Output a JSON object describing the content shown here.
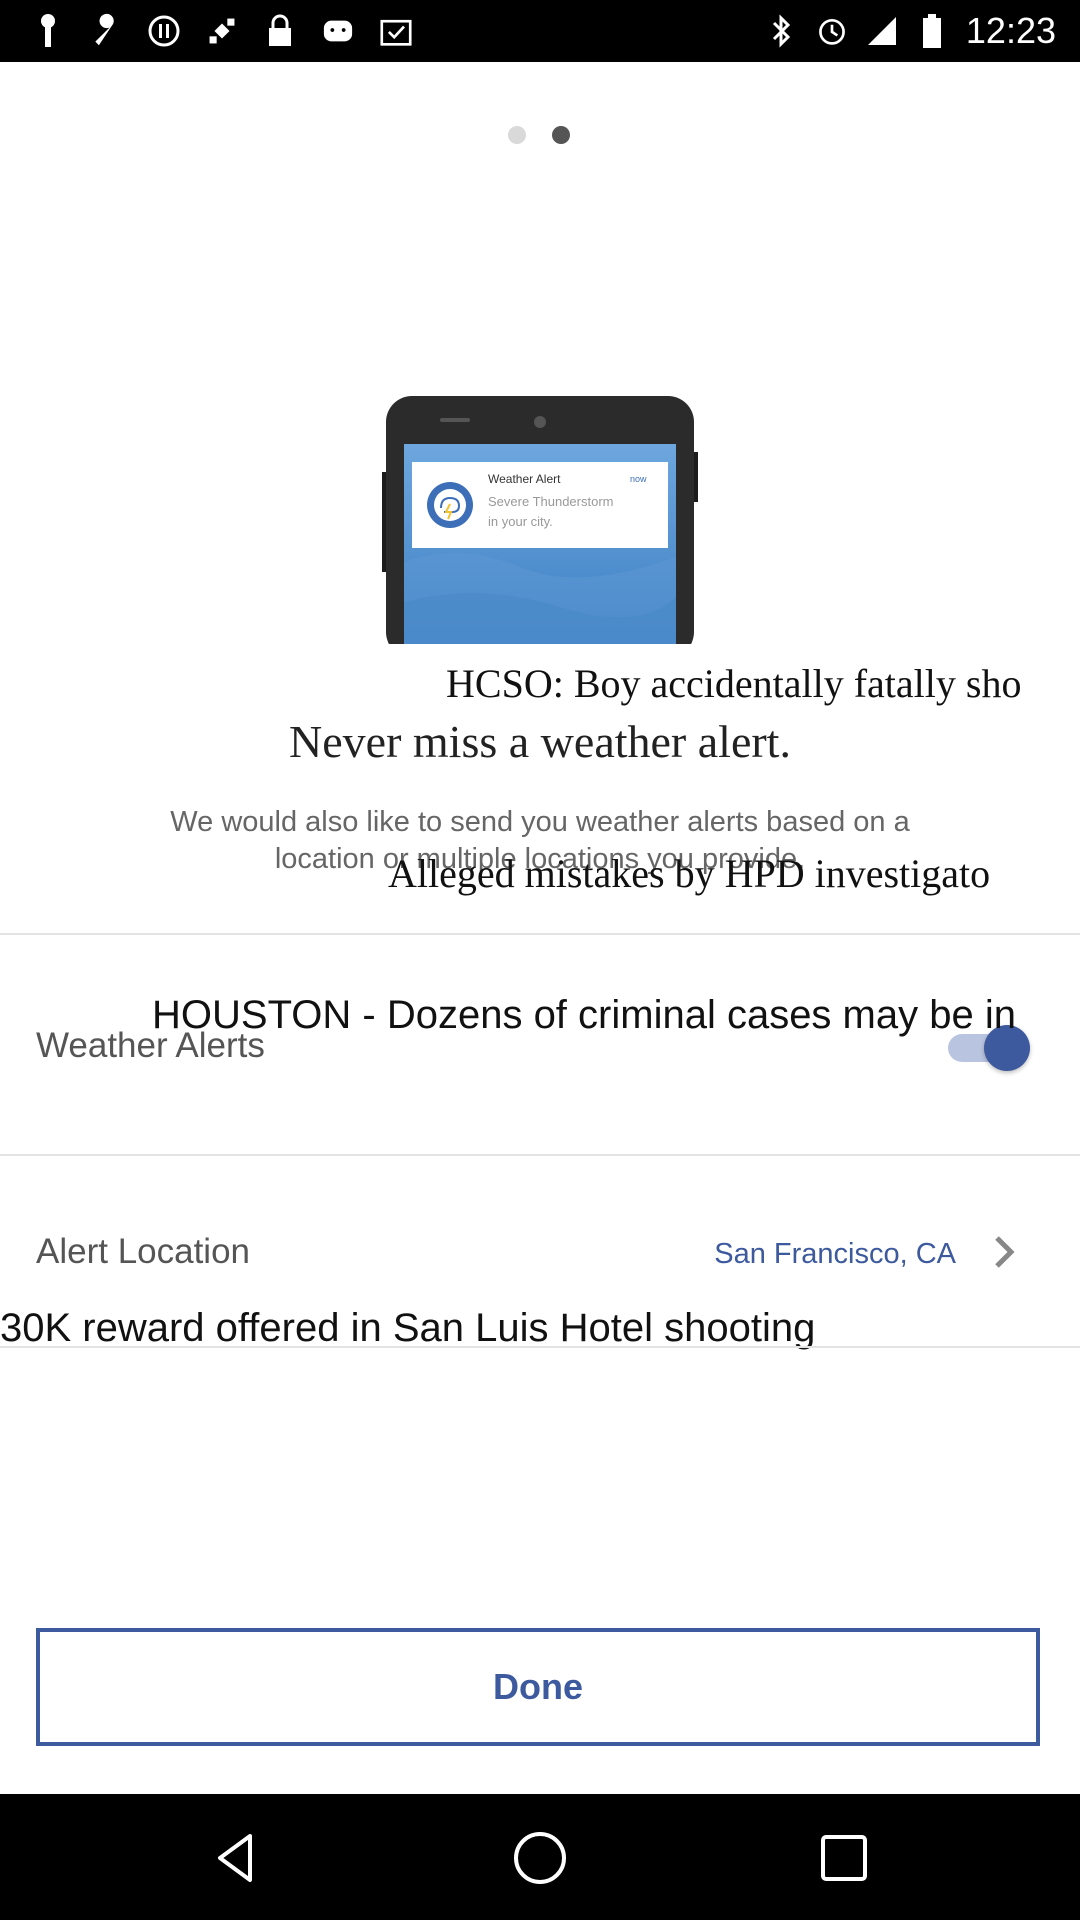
{
  "status_bar": {
    "time": "12:23",
    "left_icons": [
      "key-icon",
      "wrench-icon",
      "circle-pause-icon",
      "fake-gps-icon",
      "lock-icon",
      "android-icon",
      "clipboard-check-icon"
    ],
    "right_icons": [
      "bluetooth-icon",
      "alarm-icon",
      "signal-icon",
      "battery-icon"
    ]
  },
  "pager": {
    "pages": 2,
    "active_index": 1
  },
  "illustration": {
    "notification_title": "Weather Alert",
    "notification_time": "now",
    "notification_body_line1": "Severe Thunderstorm",
    "notification_body_line2": "in your city."
  },
  "overlay_ticker": {
    "line1": "HCSO: Boy accidentally fatally sho",
    "line2": "Alleged mistakes by HPD investigato",
    "line3": "HOUSTON -  Dozens of criminal cases may be in",
    "line4": "30K reward offered in San Luis Hotel shooting"
  },
  "main": {
    "headline": "Never miss a weather alert.",
    "subtext": "We would also like to send you weather alerts based on a location or multiple locations you provide."
  },
  "settings": {
    "weather_alerts_label": "Weather Alerts",
    "weather_alerts_enabled": true,
    "alert_location_label": "Alert Location",
    "alert_location_value": "San Francisco, CA"
  },
  "done_label": "Done",
  "colors": {
    "accent": "#3d5a9e",
    "toggle_track": "#b9c5e0"
  }
}
